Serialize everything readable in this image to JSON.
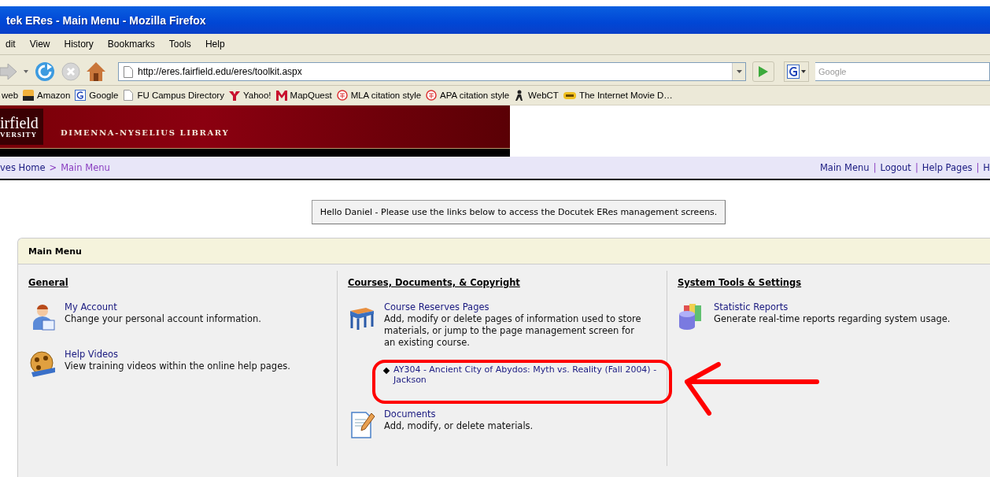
{
  "window": {
    "title": "tek ERes - Main Menu - Mozilla Firefox"
  },
  "menu_bar": [
    "dit",
    "View",
    "History",
    "Bookmarks",
    "Tools",
    "Help"
  ],
  "nav_toolbar": {
    "url": "http://eres.fairfield.edu/eres/toolkit.aspx",
    "search": {
      "placeholder": "Google"
    }
  },
  "bookmarks": [
    "web",
    "Amazon",
    "Google",
    "FU Campus Directory",
    "Yahoo!",
    "MapQuest",
    "MLA citation style",
    "APA citation style",
    "WebCT",
    "The Internet Movie D…"
  ],
  "banner": {
    "logo_line_1": "irfield",
    "logo_line_2": "VERSITY",
    "library": "DIMENNA-NYSELIUS LIBRARY"
  },
  "breadcrumb": [
    {
      "kind": "link",
      "text": "ves Home",
      "visited": false
    },
    {
      "kind": "separator",
      "text": ">"
    },
    {
      "kind": "link",
      "text": "Main Menu",
      "visited": true
    }
  ],
  "top_links": [
    {
      "kind": "link",
      "text": "Main Menu"
    },
    {
      "kind": "separator",
      "text": "|"
    },
    {
      "kind": "link",
      "text": "Logout"
    },
    {
      "kind": "separator",
      "text": "|"
    },
    {
      "kind": "link",
      "text": "Help Pages"
    },
    {
      "kind": "separator",
      "text": "|"
    },
    {
      "kind": "link",
      "text": "H"
    }
  ],
  "greeting": "Hello Daniel - Please use the links below to access the Docutek ERes management screens.",
  "main_menu": {
    "title": "Main Menu",
    "columns": [
      {
        "heading": "General",
        "items": [
          {
            "title": "My Account",
            "description": "Change your personal account information."
          },
          {
            "title": "Help Videos",
            "description": "View training videos within the online help pages."
          }
        ]
      },
      {
        "heading": "Courses, Documents, & Copyright",
        "items": [
          {
            "title": "Course Reserves Pages",
            "description": "Add, modify or delete pages of information used to store materials, or jump to the page management screen for an existing course.",
            "course_links": [
              "AY304 - Ancient City of Abydos: Myth vs. Reality (Fall 2004) - Jackson"
            ]
          },
          {
            "title": "Documents",
            "description": "Add, modify, or delete materials."
          }
        ]
      },
      {
        "heading": "System Tools & Settings",
        "items": [
          {
            "title": "Statistic Reports",
            "description": "Generate real-time reports regarding system usage."
          }
        ]
      }
    ]
  },
  "highlight_outline": {
    "color": "#ff0000"
  },
  "arrow": {
    "color": "#ff0000"
  }
}
